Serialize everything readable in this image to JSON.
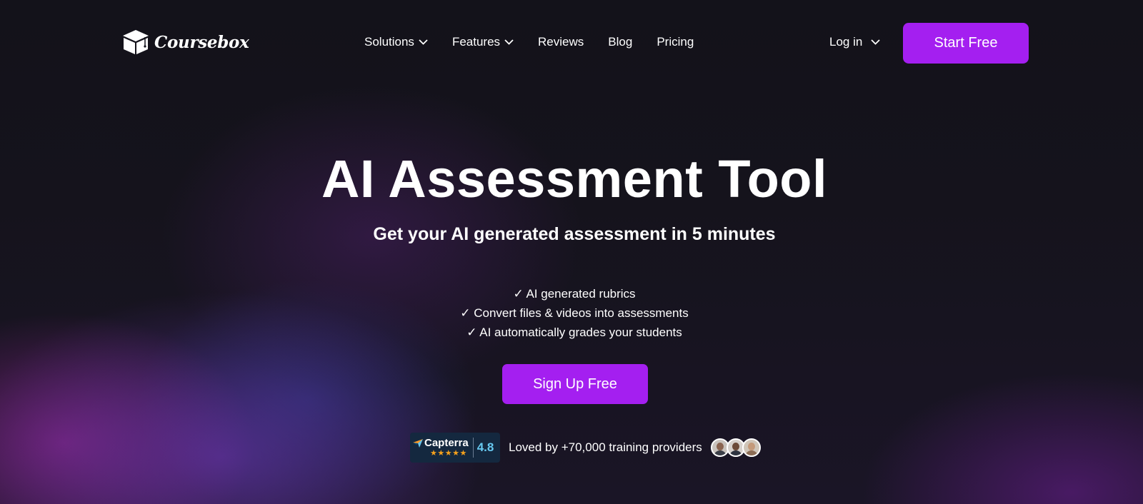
{
  "brand": {
    "name": "Coursebox",
    "logo_icon": "graduation-cap-box-icon"
  },
  "nav": {
    "items": [
      {
        "label": "Solutions",
        "has_dropdown": true
      },
      {
        "label": "Features",
        "has_dropdown": true
      },
      {
        "label": "Reviews",
        "has_dropdown": false
      },
      {
        "label": "Blog",
        "has_dropdown": false
      },
      {
        "label": "Pricing",
        "has_dropdown": false
      }
    ],
    "login_label": "Log in",
    "cta_label": "Start Free"
  },
  "hero": {
    "title": "AI Assessment Tool",
    "subtitle": "Get your AI generated assessment in 5 minutes",
    "features": [
      "✓ AI generated rubrics",
      "✓ Convert files & videos into assessments",
      "✓ AI automatically grades your students"
    ],
    "cta_label": "Sign Up Free"
  },
  "social_proof": {
    "badge_name": "Capterra",
    "badge_score": "4.8",
    "badge_stars": "★★★★★",
    "text": "Loved by +70,000 training providers",
    "avatars": [
      "avatar-1",
      "avatar-2",
      "avatar-3"
    ]
  },
  "colors": {
    "accent": "#a41ff0",
    "background": "#13121b",
    "capterra_bg": "#14283f",
    "capterra_score": "#67c9f0",
    "star": "#f6a11c"
  }
}
